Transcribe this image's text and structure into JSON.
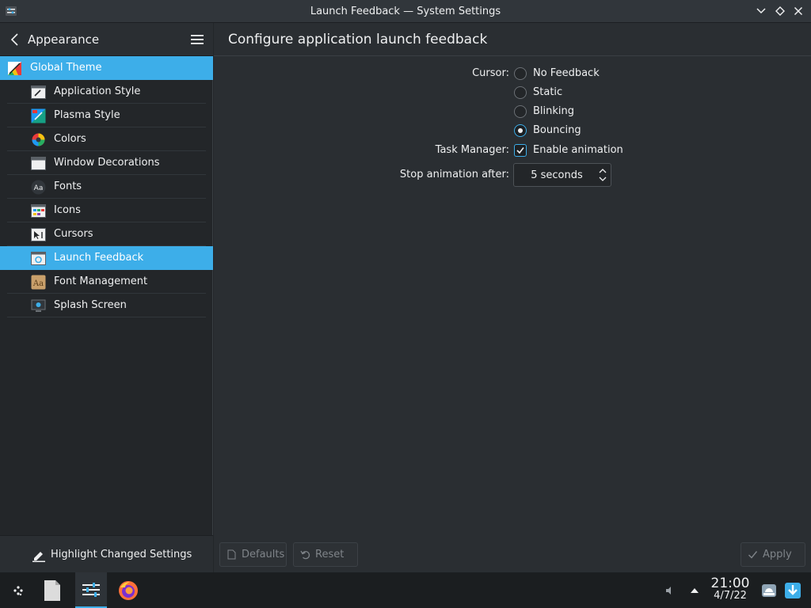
{
  "window": {
    "title": "Launch Feedback — System Settings"
  },
  "sidebar": {
    "breadcrumb": "Appearance",
    "items": [
      {
        "label": "Global Theme",
        "icon": "global-theme-icon"
      },
      {
        "label": "Application Style",
        "icon": "application-style-icon"
      },
      {
        "label": "Plasma Style",
        "icon": "plasma-style-icon"
      },
      {
        "label": "Colors",
        "icon": "colors-icon"
      },
      {
        "label": "Window Decorations",
        "icon": "window-decorations-icon"
      },
      {
        "label": "Fonts",
        "icon": "fonts-icon"
      },
      {
        "label": "Icons",
        "icon": "icons-icon"
      },
      {
        "label": "Cursors",
        "icon": "cursors-icon"
      },
      {
        "label": "Launch Feedback",
        "icon": "launch-feedback-icon"
      },
      {
        "label": "Font Management",
        "icon": "font-management-icon"
      },
      {
        "label": "Splash Screen",
        "icon": "splash-screen-icon"
      }
    ],
    "selected_index": 8,
    "footer_label": "Highlight Changed Settings"
  },
  "main": {
    "page_title": "Configure application launch feedback",
    "cursor_label": "Cursor:",
    "cursor_options": [
      "No Feedback",
      "Static",
      "Blinking",
      "Bouncing"
    ],
    "cursor_selected": "Bouncing",
    "task_manager_label": "Task Manager:",
    "task_manager_option": "Enable animation",
    "task_manager_checked": true,
    "stop_animation_label": "Stop animation after:",
    "stop_animation_value": "5 seconds",
    "buttons": {
      "defaults": "Defaults",
      "reset": "Reset",
      "apply": "Apply"
    }
  },
  "taskbar": {
    "time": "21:00",
    "date": "4/7/22"
  },
  "colors": {
    "accent": "#3daee9",
    "background": "#232629",
    "panel": "#2a2e32"
  }
}
